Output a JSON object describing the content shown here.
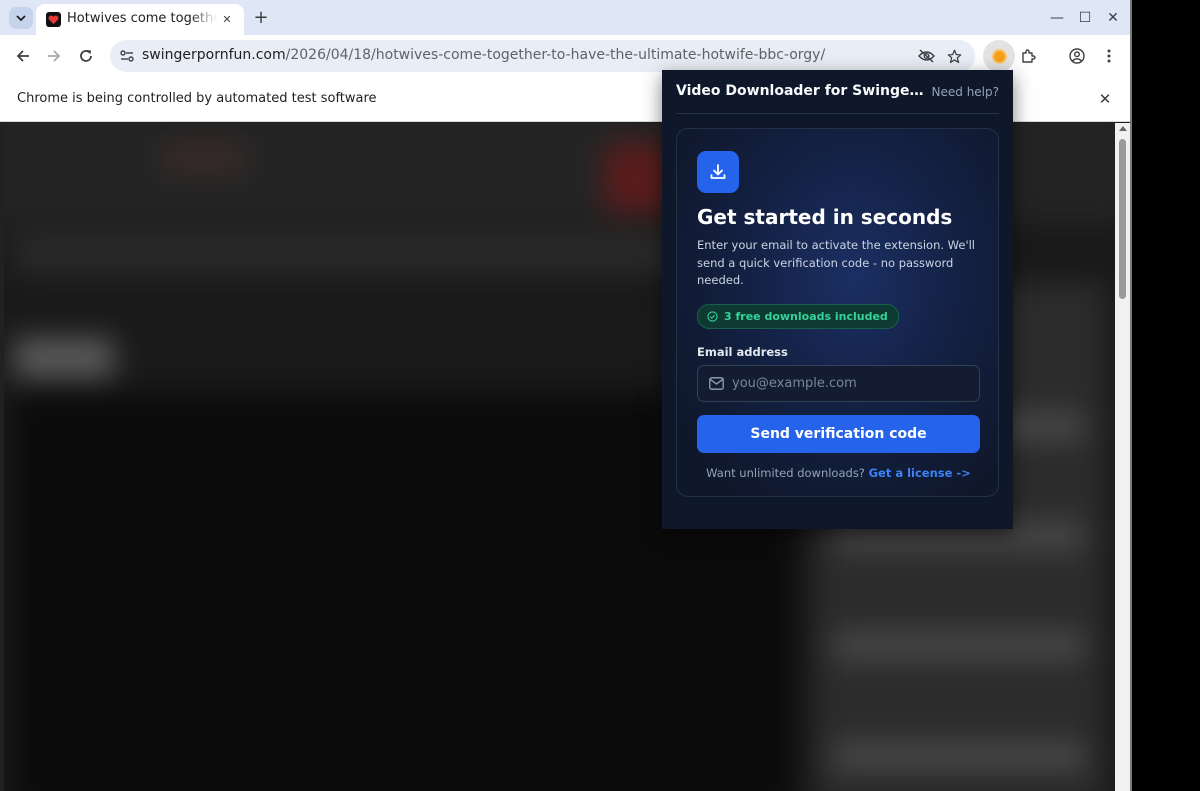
{
  "browser": {
    "tab": {
      "title": "Hotwives come together to have the ultimate hotwife bbc orgy",
      "close_glyph": "✕"
    },
    "new_tab_glyph": "+",
    "window_controls": {
      "minimize": "—",
      "maximize": "☐",
      "close": "✕"
    },
    "omnibox": {
      "host": "swingerpornfun.com",
      "path": "/2026/04/18/hotwives-come-together-to-have-the-ultimate-hotwife-bbc-orgy/"
    },
    "infobar": {
      "text": "Chrome is being controlled by automated test software",
      "close_glyph": "✕"
    }
  },
  "popup": {
    "title": "Video Downloader for SwingerPornFun",
    "help_link": "Need help?",
    "heading": "Get started in seconds",
    "description": "Enter your email to activate the extension. We'll send a quick verification code - no password needed.",
    "badge": "3 free downloads included",
    "email_label": "Email address",
    "email_placeholder": "you@example.com",
    "email_value": "",
    "submit_button": "Send verification code",
    "footer_prompt": "Want unlimited downloads?",
    "footer_link": "Get a license ->"
  },
  "colors": {
    "popup_bg": "#0f172a",
    "accent": "#2563eb",
    "success": "#34d399",
    "link": "#3b82f6"
  },
  "icons": [
    "tab-search-icon",
    "favicon-icon",
    "back-arrow-icon",
    "forward-arrow-icon",
    "reload-icon",
    "site-info-icon",
    "eye-off-icon",
    "star-icon",
    "extension-icon",
    "puzzle-icon",
    "profile-icon",
    "more-vert-icon",
    "download-icon",
    "check-circle-icon",
    "mail-icon"
  ]
}
